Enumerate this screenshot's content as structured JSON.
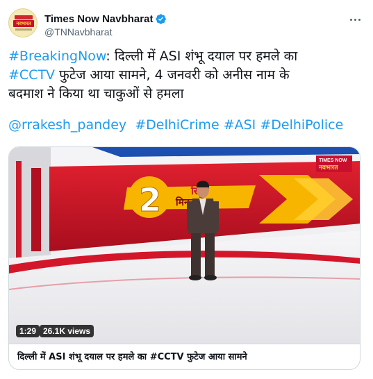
{
  "account": {
    "display_name": "Times Now Navbharat",
    "handle": "@TNNavbharat",
    "verified": true,
    "avatar_logo_text": "नवभारत"
  },
  "tweet": {
    "line1_hashtag": "#BreakingNow",
    "line1_rest": ": दिल्ली में ASI शंभू दयाल पर हमले का",
    "line2_hashtag": "#CCTV",
    "line2_rest": " फुटेज आया सामने, 4 जनवरी को अनीस नाम के",
    "line3": "बदमाश ने किया था चाकुओं से हमला",
    "mentions": [
      "@rrakesh_pandey",
      "#DelhiCrime",
      "#ASI",
      "#DelhiPolice"
    ]
  },
  "media": {
    "duration": "1:29",
    "views": "26.1K views",
    "caption": "दिल्ली में ASI शंभू दयाल पर हमले का #CCTV फुटेज आया सामने",
    "screen_text_line1": "सिर्फ",
    "screen_text_line2": "मिनट में",
    "screen_digit": "2",
    "channel_logo_top": "TIMES NOW",
    "channel_logo_bottom": "नवभारत"
  },
  "colors": {
    "link": "#1d9bf0",
    "verified": "#1d9bf0",
    "studio_red": "#c8162a",
    "studio_yellow": "#f7b500"
  },
  "icons": [
    "verified-badge-icon",
    "more-options-icon"
  ]
}
